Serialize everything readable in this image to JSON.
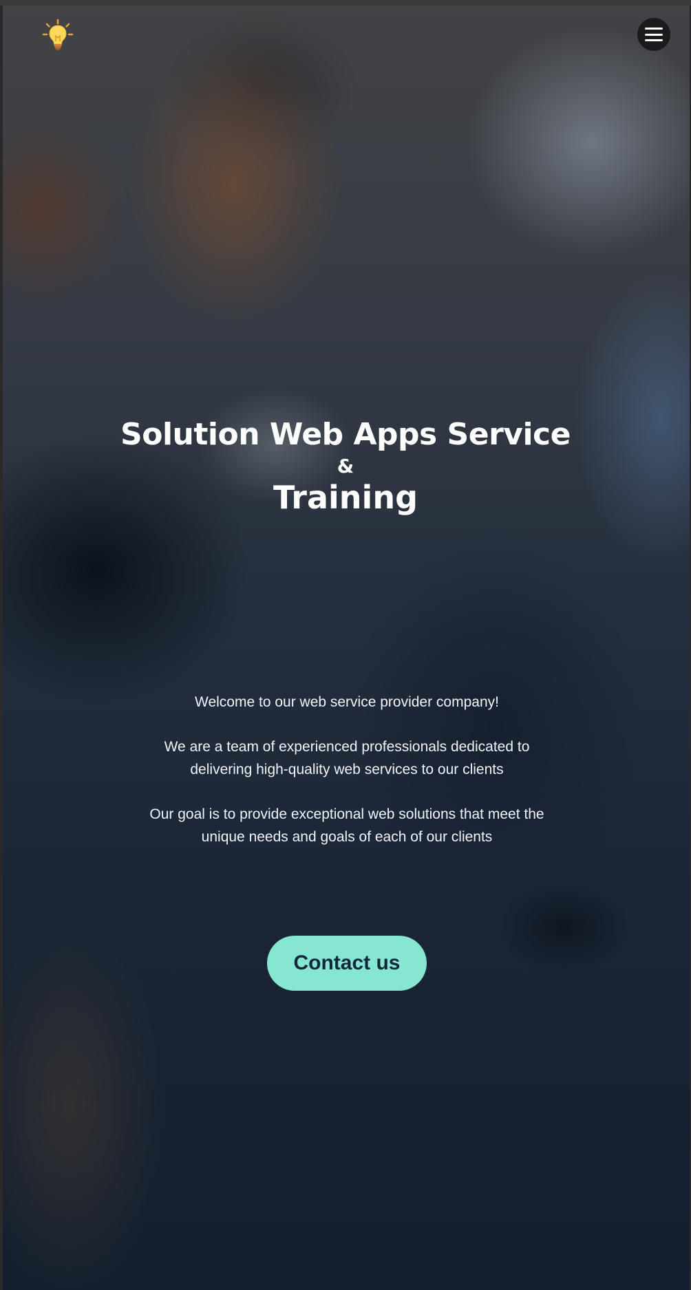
{
  "header": {
    "logo_icon": "lightbulb-icon",
    "menu_icon": "hamburger-menu-icon"
  },
  "hero": {
    "title": "Solution Web Apps Service",
    "ampersand": "&",
    "subtitle": "Training"
  },
  "intro": {
    "welcome": "Welcome to our web service provider company!",
    "team": "We are a team of experienced professionals dedicated to delivering high-quality web services to our clients",
    "goal": "Our goal is to provide exceptional web solutions that meet the unique needs and goals of each of our clients"
  },
  "cta": {
    "label": "Contact us",
    "color": "#86e6d2",
    "text_color": "#11283a"
  },
  "colors": {
    "overlay": "#162134",
    "menu_button_bg": "#1b1b1d"
  }
}
